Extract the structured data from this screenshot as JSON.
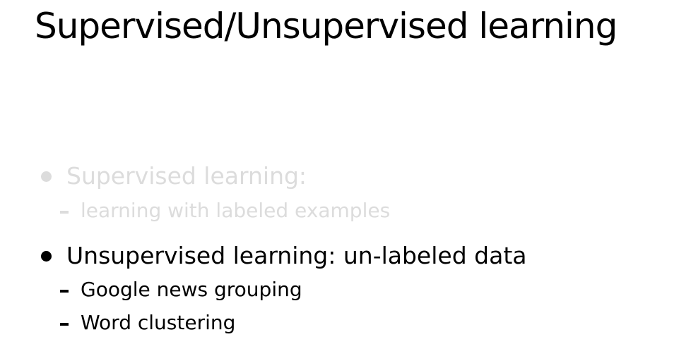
{
  "slide": {
    "title": "Supervised/Unsupervised learning",
    "items": [
      {
        "text": "Supervised learning:",
        "state": "faded",
        "sub_items": [
          "learning with labeled examples"
        ]
      },
      {
        "text": "Unsupervised learning: un-labeled data",
        "state": "active",
        "sub_items": [
          "Google news grouping",
          "Word clustering"
        ]
      }
    ]
  },
  "colors": {
    "active_text": "#000000",
    "faded_text": "#dcdcdc",
    "background": "#ffffff"
  }
}
